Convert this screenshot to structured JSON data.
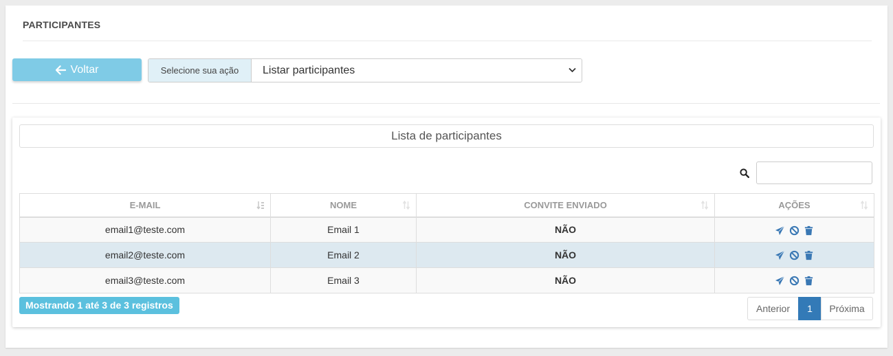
{
  "page": {
    "title": "PARTICIPANTES"
  },
  "toolbar": {
    "back_label": "Voltar",
    "action_addon": "Selecione sua ação",
    "action_selected": "Listar participantes"
  },
  "list": {
    "header": "Lista de participantes",
    "search_value": "",
    "columns": [
      "E-MAIL",
      "NOME",
      "CONVITE ENVIADO",
      "AÇÕES"
    ],
    "rows": [
      {
        "email": "email1@teste.com",
        "nome": "Email 1",
        "convite": "NÃO"
      },
      {
        "email": "email2@teste.com",
        "nome": "Email 2",
        "convite": "NÃO"
      },
      {
        "email": "email3@teste.com",
        "nome": "Email 3",
        "convite": "NÃO"
      }
    ],
    "row_actions": [
      "send-icon",
      "ban-icon",
      "trash-icon"
    ],
    "info": "Mostrando 1 até 3 de 3 registros",
    "pagination": {
      "prev": "Anterior",
      "current": "1",
      "next": "Próxima"
    }
  },
  "colors": {
    "accent": "#337ab7",
    "back_button": "#7fcbe6",
    "info_badge": "#5bc0de",
    "status_no": "#e00000",
    "addon_bg": "#e0f0f7"
  }
}
